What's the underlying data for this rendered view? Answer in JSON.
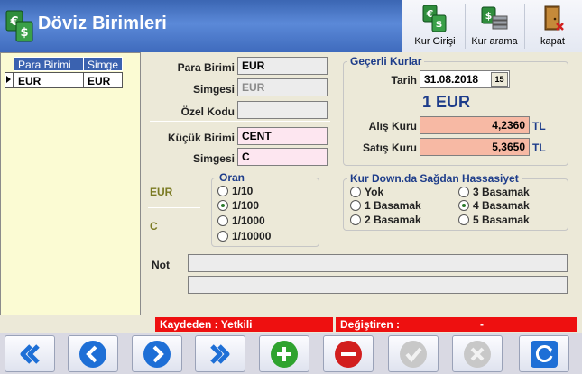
{
  "window": {
    "title": "Döviz Birimleri"
  },
  "toolbar": {
    "kur_girisi": "Kur Girişi",
    "kur_arama": "Kur arama",
    "kapat": "kapat"
  },
  "list": {
    "columns": [
      "Para Birimi",
      "Simge"
    ],
    "rows": [
      {
        "para_birimi": "EUR",
        "simge": "EUR"
      }
    ]
  },
  "form": {
    "para_birimi_label": "Para Birimi",
    "para_birimi_value": "EUR",
    "simgesi_label": "Simgesi",
    "simgesi_value": "EUR",
    "ozel_kodu_label": "Özel Kodu",
    "ozel_kodu_value": "",
    "kucuk_birimi_label": "Küçük Birimi",
    "kucuk_birimi_value": "CENT",
    "simgesi2_label": "Simgesi",
    "simgesi2_value": "C",
    "not_label": "Not",
    "not_value1": "",
    "not_value2": ""
  },
  "oran": {
    "title": "Oran",
    "left_top": "EUR",
    "left_bottom": "C",
    "options": [
      "1/10",
      "1/100",
      "1/1000",
      "1/10000"
    ],
    "selected_index": 1
  },
  "kurlar": {
    "title": "Geçerli Kurlar",
    "tarih_label": "Tarih",
    "tarih_value": "31.08.2018",
    "calendar_icon_text": "15",
    "unit_heading": "1 EUR",
    "alis_label": "Alış Kuru",
    "alis_value": "4,2360",
    "satis_label": "Satış Kuru",
    "satis_value": "5,3650",
    "currency": "TL"
  },
  "hassasiyet": {
    "title": "Kur Down.da Sağdan Hassasiyet",
    "options": [
      "Yok",
      "1 Basamak",
      "2 Basamak",
      "3 Basamak",
      "4 Basamak",
      "5 Basamak"
    ],
    "selected_index": 4
  },
  "status": {
    "kaydeden": "Kaydeden : Yetkili",
    "degistiren": "Değiştiren :",
    "degistiren_value": "-"
  },
  "colors": {
    "header_blue": "#3f6bbd",
    "status_red": "#ee1010",
    "nav_blue": "#1e6fd6",
    "add_green": "#2fa32f",
    "delete_red": "#d21e1e"
  },
  "nav": {
    "buttons": [
      "first-icon",
      "prev-icon",
      "next-icon",
      "last-icon",
      "add-icon",
      "delete-icon",
      "confirm-icon",
      "cancel-icon",
      "refresh-icon"
    ]
  }
}
